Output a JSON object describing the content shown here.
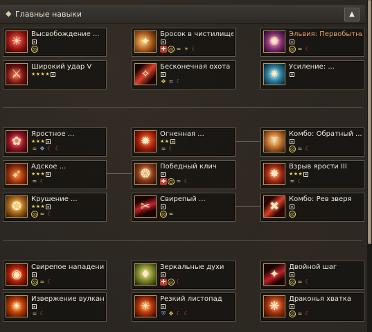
{
  "header": {
    "title": "Главные навыки",
    "toggle_glyph": "▲"
  },
  "skills": {
    "release": {
      "name": "Высвобождение ...",
      "rank": "",
      "icon": "☀",
      "feats": [
        "⊙"
      ]
    },
    "purgatory": {
      "name": "Бросок в чистилище",
      "rank": "",
      "icon": "✦",
      "feats": [
        "✚",
        "⊙",
        "≈",
        "✶",
        "☾"
      ]
    },
    "elvia": {
      "name": "Эльвия: Первобытны...",
      "rank": "",
      "icon": "✺",
      "feats": [
        "⊙",
        "≈",
        "☾"
      ]
    },
    "wide_strike": {
      "name": "Широкий удар V",
      "rank": "★★★★",
      "icon": "⚔",
      "feats": []
    },
    "endless_hunt": {
      "name": "Бесконечная охота",
      "rank": "",
      "icon": "✧",
      "feats": [
        "✥",
        "≈",
        "☾"
      ]
    },
    "boost": {
      "name": "Усиление: ...",
      "rank": "",
      "icon": "✷",
      "feats": []
    },
    "furious": {
      "name": "Яростное ...",
      "rank": "★★★",
      "icon": "✿",
      "feats": [
        "≈",
        "✥",
        "☾",
        "☾"
      ]
    },
    "fiery": {
      "name": "Огненная ...",
      "rank": "★★",
      "icon": "✹",
      "feats": [
        "≈",
        "☾"
      ]
    },
    "combo_reverse": {
      "name": "Комбо: Обратный ...",
      "rank": "",
      "icon": "⚚",
      "feats": [
        "⊙",
        "≈",
        "☾"
      ]
    },
    "hellish": {
      "name": "Адское ...",
      "rank": "★★★",
      "icon": "➶",
      "feats": [
        "≈",
        "☾"
      ]
    },
    "victory_cry": {
      "name": "Победный клич",
      "rank": "",
      "icon": "❂",
      "feats": [
        "✚",
        "⊙",
        "≈",
        "☾"
      ]
    },
    "rage_burst": {
      "name": "Взрыв ярости III",
      "rank": "★★★",
      "icon": "✸",
      "feats": [
        "≈",
        "☾"
      ]
    },
    "crash": {
      "name": "Крушение ...",
      "rank": "★★★",
      "icon": "✪",
      "feats": [
        "⊙",
        "≈",
        "☾"
      ]
    },
    "fierce": {
      "name": "Свирепый ...",
      "rank": "",
      "icon": "✂",
      "feats": [
        "⊙",
        "≈"
      ]
    },
    "combo_beast": {
      "name": "Комбо: Рев зверя",
      "rank": "",
      "icon": "✖",
      "feats": [
        "⊙"
      ]
    },
    "fierce_attack": {
      "name": "Свирепое нападение",
      "rank": "",
      "icon": "◉",
      "feats": [
        "⊙",
        "≈",
        "☾"
      ]
    },
    "mirror_spirits": {
      "name": "Зеркальные духи",
      "rank": "",
      "icon": "♦",
      "feats": [
        "✚",
        "⊙",
        "☾"
      ]
    },
    "double_step": {
      "name": "Двойной шаг",
      "rank": "",
      "icon": "✦",
      "feats": [
        "⊙",
        "≈",
        "☾"
      ]
    },
    "eruption": {
      "name": "Извержение вулкана",
      "rank": "",
      "icon": "✴",
      "feats": [
        "≈",
        "☾"
      ]
    },
    "leaf_fall": {
      "name": "Резкий листопад",
      "rank": "",
      "icon": "✳",
      "feats": [
        "⛨",
        "✥",
        "☾",
        "☾"
      ]
    },
    "dragon_grip": {
      "name": "Драконья хватка",
      "rank": "",
      "icon": "❋",
      "feats": [
        "⊙",
        "≈",
        "☾"
      ]
    }
  },
  "colors": {
    "accent_orange": "#e79a66",
    "star_gold": "#ecd35a",
    "icon_frame": "#b89a5c"
  }
}
